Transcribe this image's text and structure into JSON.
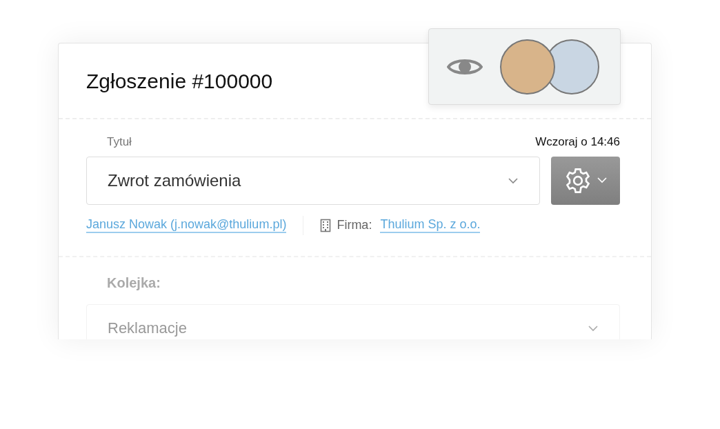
{
  "ticket": {
    "title": "Zgłoszenie #100000"
  },
  "title_field": {
    "label": "Tytuł",
    "timestamp": "Wczoraj o 14:46",
    "value": "Zwrot zamówienia"
  },
  "contact": {
    "link": "Janusz Nowak (j.nowak@thulium.pl)",
    "company_label": "Firma:",
    "company_link": "Thulium Sp. z o.o."
  },
  "queue_field": {
    "label": "Kolejka:",
    "value": "Reklamacje"
  }
}
